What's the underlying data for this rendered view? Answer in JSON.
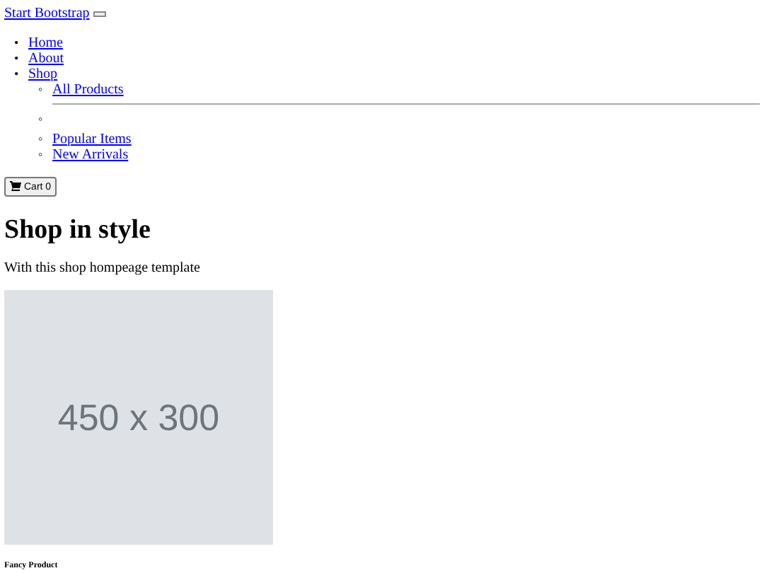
{
  "navbar": {
    "brand": "Start Bootstrap",
    "nav_items": [
      {
        "marker": "•",
        "label": "Home"
      },
      {
        "marker": "•",
        "label": "About"
      },
      {
        "marker": "•",
        "label": "Shop",
        "children": [
          {
            "kind": "link",
            "marker": "◦",
            "label": "All Products"
          },
          {
            "kind": "divider",
            "marker": "◦"
          },
          {
            "kind": "link",
            "marker": "◦",
            "label": "Popular Items"
          },
          {
            "kind": "link",
            "marker": "◦",
            "label": "New Arrivals"
          }
        ]
      }
    ],
    "cart": {
      "label": "Cart",
      "count": "0"
    }
  },
  "header": {
    "title": "Shop in style",
    "subtitle": "With this shop hompeage template"
  },
  "product": {
    "image_text": "450 x 300",
    "name": "Fancy Product"
  }
}
